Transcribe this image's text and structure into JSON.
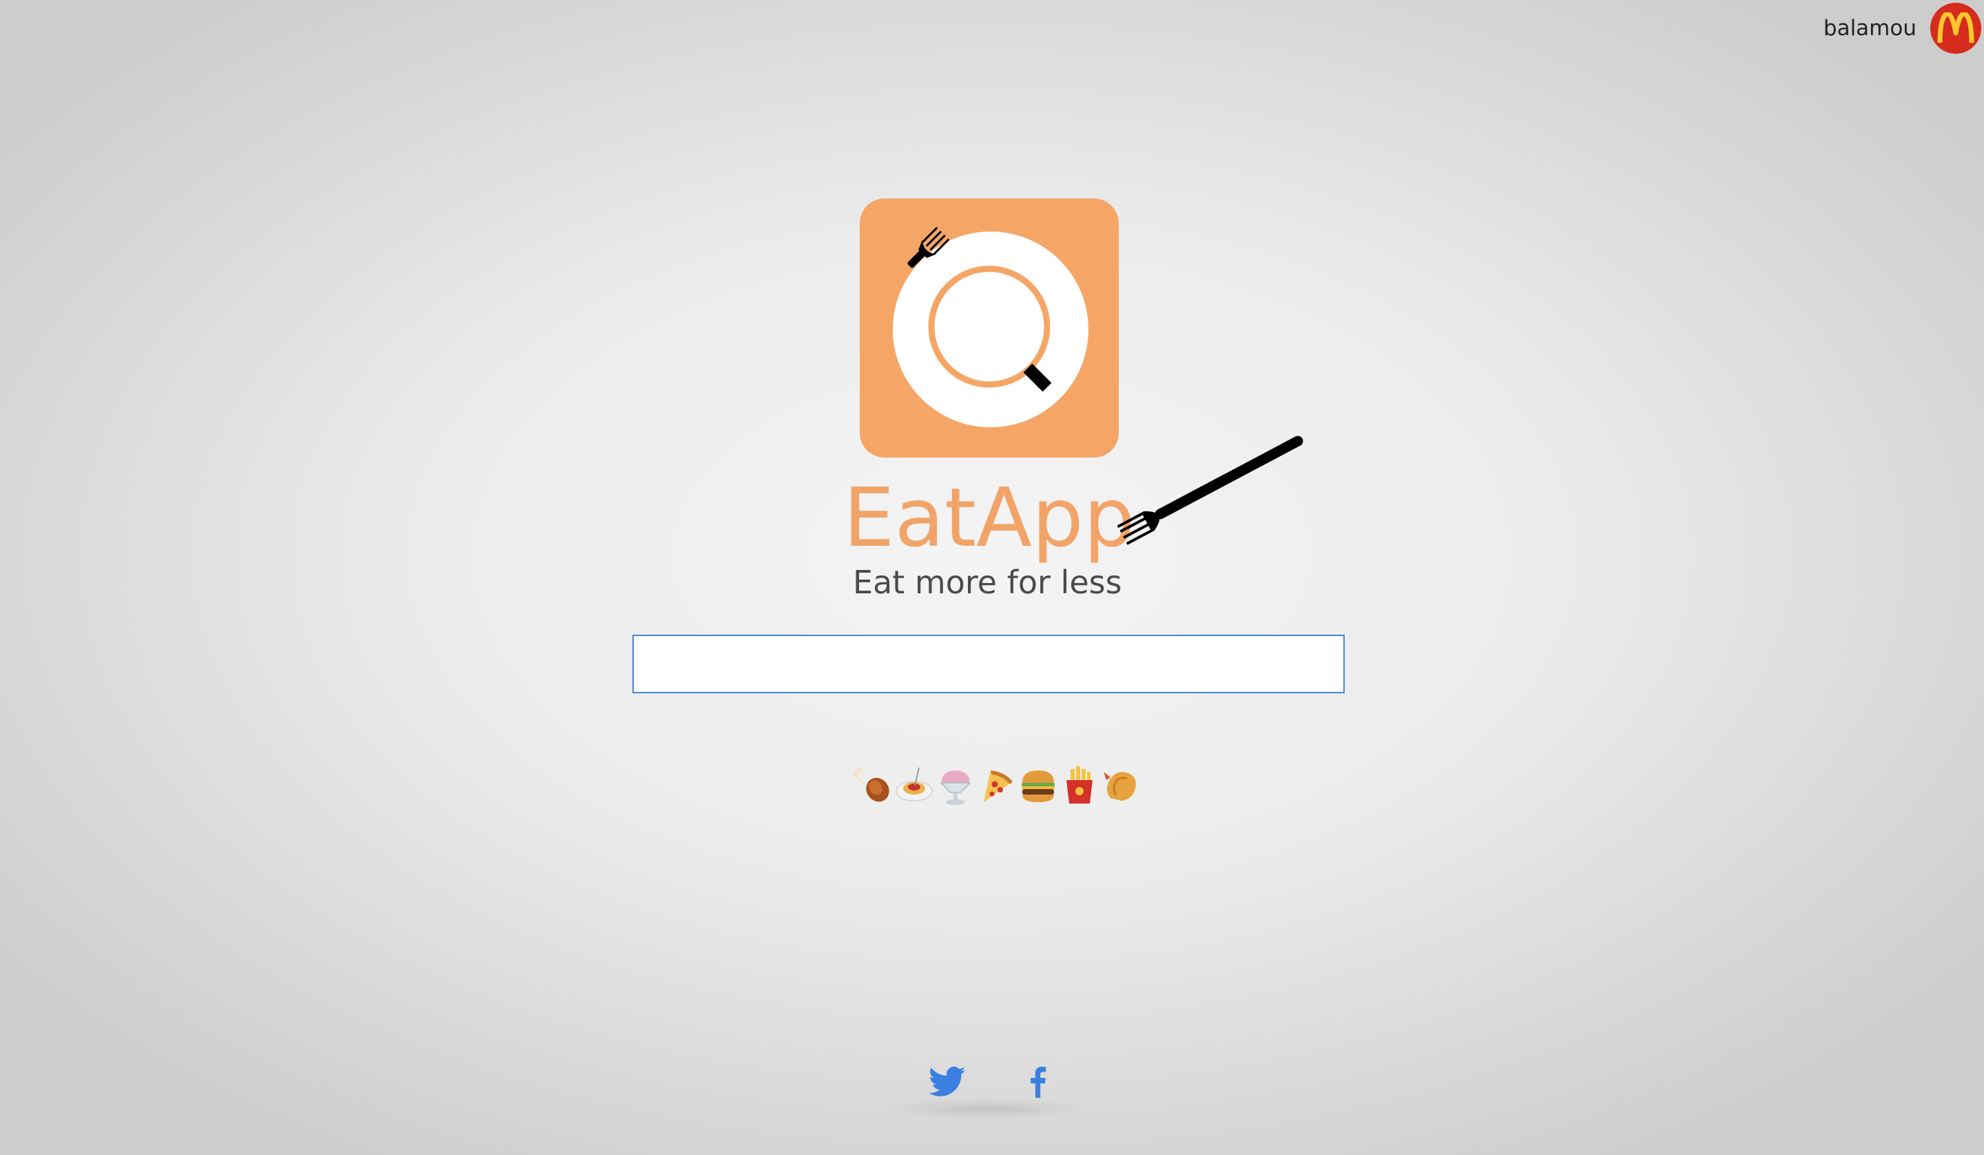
{
  "header": {
    "username": "balamou",
    "avatar_icon": "mcdonalds-logo-icon",
    "avatar_color": "#d52c1e"
  },
  "brand": {
    "name": "EatApp",
    "tagline": "Eat more for less",
    "color": "#f5a667"
  },
  "search": {
    "value": "",
    "placeholder": ""
  },
  "food_icons": [
    {
      "icon": "poultry-leg-icon"
    },
    {
      "icon": "spaghetti-icon"
    },
    {
      "icon": "shaved-ice-icon"
    },
    {
      "icon": "pizza-icon"
    },
    {
      "icon": "hamburger-icon"
    },
    {
      "icon": "french-fries-icon"
    },
    {
      "icon": "fried-shrimp-icon"
    }
  ],
  "footer": {
    "links": [
      {
        "icon": "twitter-icon",
        "color": "#3b7fe0"
      },
      {
        "icon": "facebook-icon",
        "color": "#3b7fe0"
      }
    ]
  }
}
